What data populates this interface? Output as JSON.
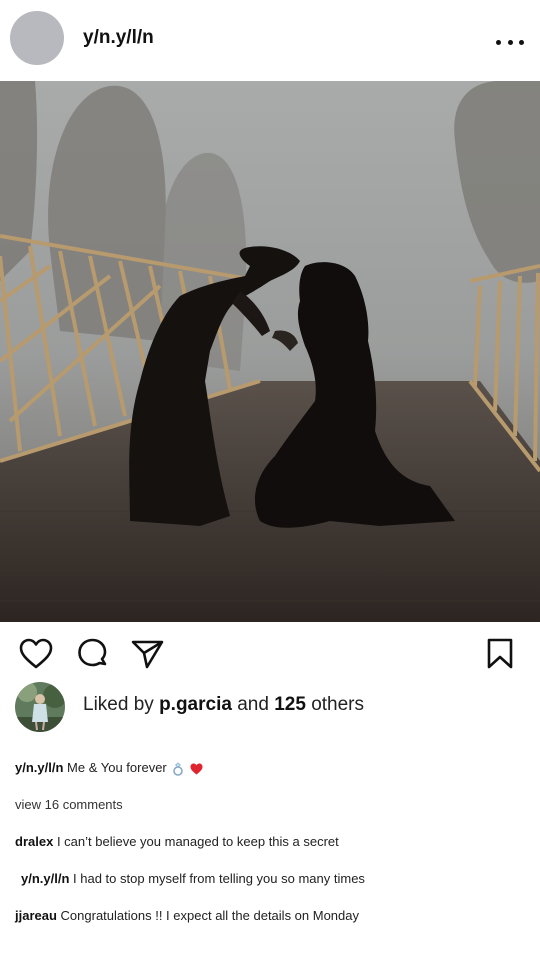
{
  "post": {
    "author": "y/n.y/l/n",
    "more_icon": "more-horizontal-icon"
  },
  "actions": {
    "like_icon": "heart-icon",
    "comment_icon": "comment-icon",
    "share_icon": "send-icon",
    "save_icon": "bookmark-icon"
  },
  "likes": {
    "prefix": "Liked by",
    "user": "p.garcia",
    "middle": "and",
    "count": "125",
    "suffix": "others"
  },
  "caption": {
    "user": "y/n.y/l/n",
    "text": "Me & You forever"
  },
  "view_comments": "view 16 comments",
  "comments": [
    {
      "user": "dralex",
      "text": "I can’t believe you managed to keep this a secret"
    },
    {
      "user": "y/n.y/l/n",
      "text": "I had to stop myself from telling you so many times"
    },
    {
      "user": "jjareau",
      "text": "Congratulations !! I expect all the details on Monday"
    }
  ]
}
